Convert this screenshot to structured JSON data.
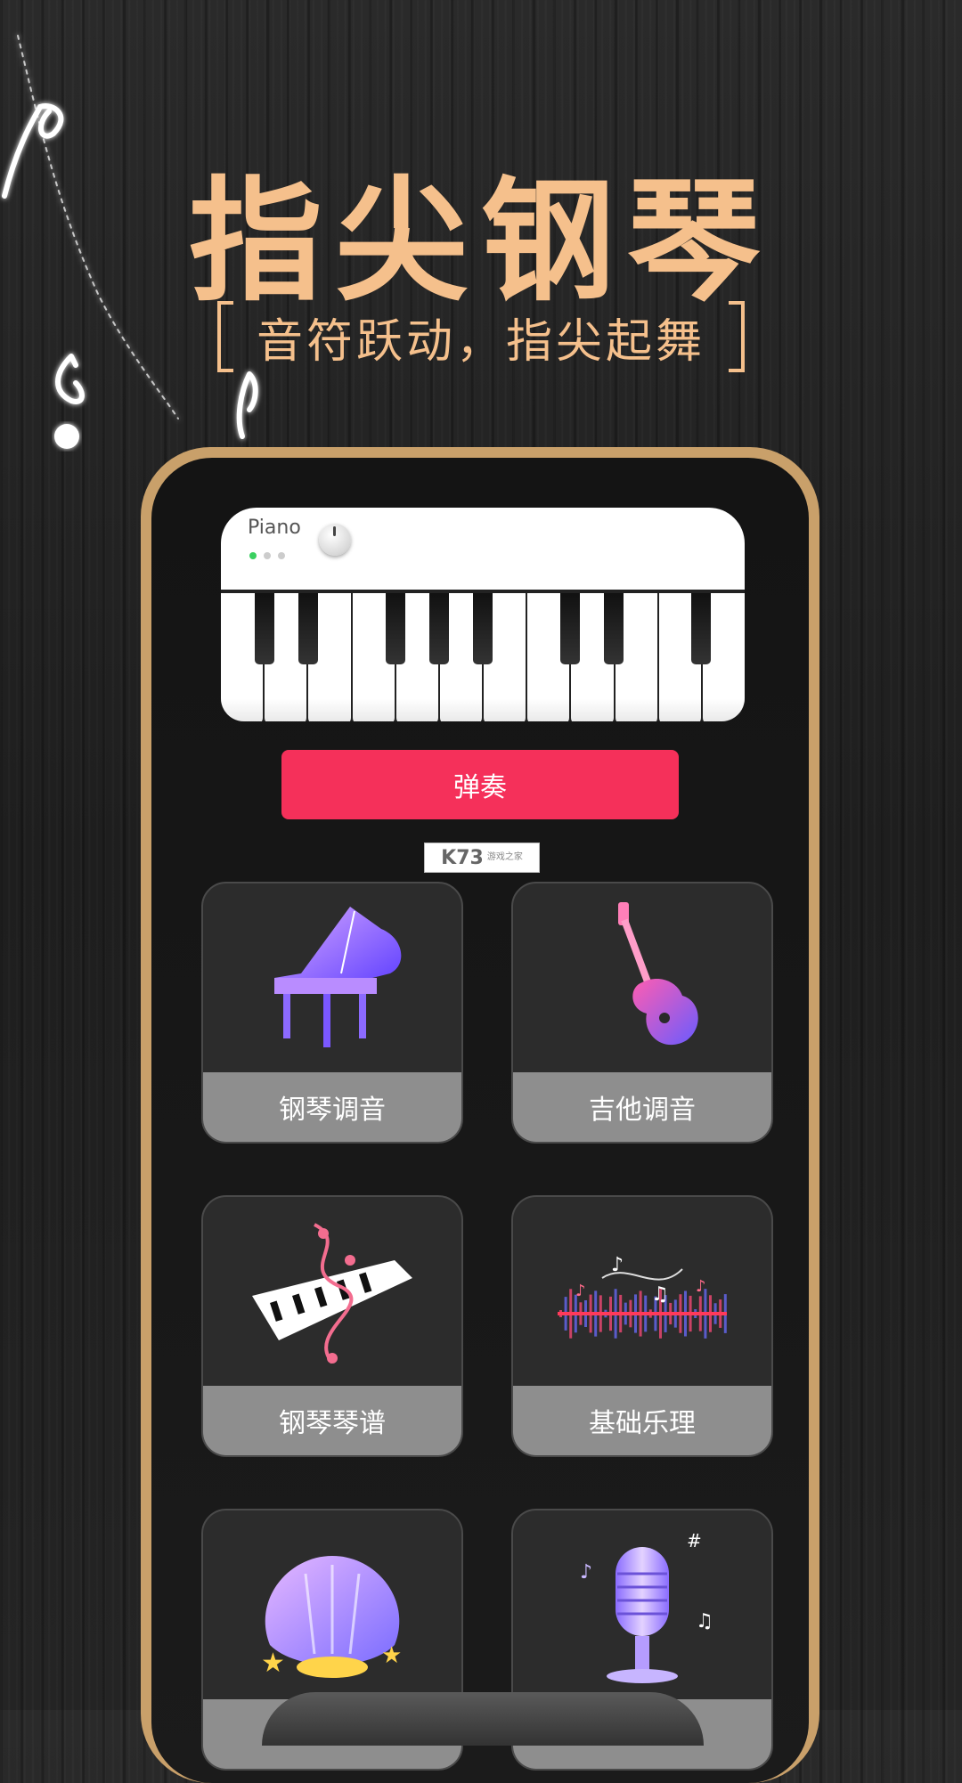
{
  "hero": {
    "title": "指尖钢琴",
    "subtitle": "音符跃动，指尖起舞"
  },
  "piano_preview": {
    "label": "Piano"
  },
  "play_button": {
    "label": "弹奏"
  },
  "watermark": {
    "text": "K73",
    "sub": "游戏之家"
  },
  "tiles": [
    {
      "label": "钢琴调音",
      "icon": "grand-piano-icon"
    },
    {
      "label": "吉他调音",
      "icon": "guitar-icon"
    },
    {
      "label": "钢琴琴谱",
      "icon": "sheet-music-keys-icon"
    },
    {
      "label": "基础乐理",
      "icon": "music-wave-icon"
    },
    {
      "label": "",
      "icon": "music-shell-icon"
    },
    {
      "label": "",
      "icon": "microphone-icon"
    }
  ],
  "colors": {
    "accent_gold": "#f5c08c",
    "phone_frame": "#c9a06a",
    "play_button": "#f5305a",
    "tile_label_bg": "#8e8e8e"
  }
}
